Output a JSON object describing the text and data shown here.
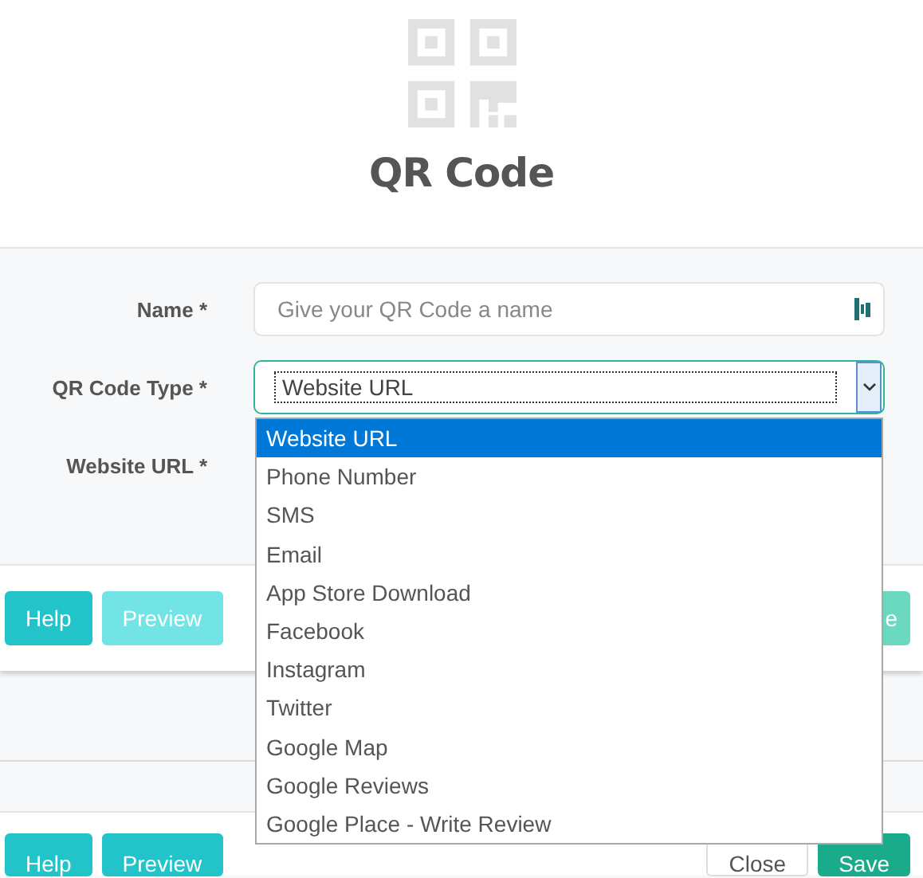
{
  "header": {
    "title": "QR Code"
  },
  "form": {
    "name": {
      "label": "Name *",
      "placeholder": "Give your QR Code a name"
    },
    "type": {
      "label": "QR Code Type *",
      "value": "Website URL",
      "expanded": true,
      "options": [
        {
          "label": "Website URL",
          "selected": true
        },
        {
          "label": "Phone Number",
          "selected": false
        },
        {
          "label": "SMS",
          "selected": false
        },
        {
          "label": "Email",
          "selected": false
        },
        {
          "label": "App Store Download",
          "selected": false
        },
        {
          "label": "Facebook",
          "selected": false
        },
        {
          "label": "Instagram",
          "selected": false
        },
        {
          "label": "Twitter",
          "selected": false
        },
        {
          "label": "Google Map",
          "selected": false
        },
        {
          "label": "Google Reviews",
          "selected": false
        },
        {
          "label": "Google Place - Write Review",
          "selected": false
        }
      ]
    },
    "website_url": {
      "label": "Website URL *"
    }
  },
  "footers": [
    {
      "left": [
        {
          "label": "Help",
          "kind": "teal",
          "disabled": false
        },
        {
          "label": "Preview",
          "kind": "teal",
          "disabled": true
        }
      ],
      "right": [
        {
          "label": "e",
          "kind": "green",
          "disabled": true
        }
      ]
    },
    {
      "left": [
        {
          "label": "Help",
          "kind": "teal",
          "disabled": false
        },
        {
          "label": "Preview",
          "kind": "teal",
          "disabled": false
        }
      ],
      "right": [
        {
          "label": "Close",
          "kind": "outline",
          "disabled": false
        },
        {
          "label": "Save",
          "kind": "green",
          "disabled": false
        }
      ]
    }
  ]
}
